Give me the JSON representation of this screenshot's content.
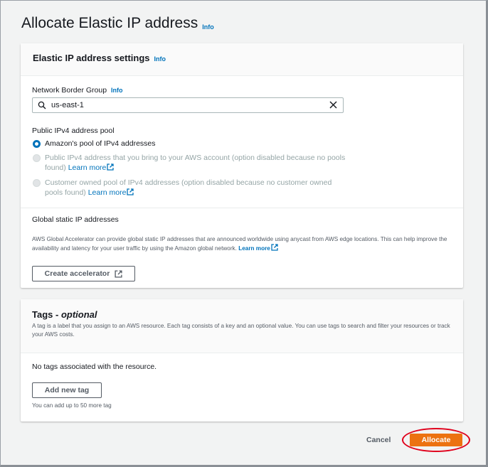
{
  "page": {
    "title": "Allocate Elastic IP address",
    "info": "Info"
  },
  "settings": {
    "header": "Elastic IP address settings",
    "info": "Info",
    "network_border_group": {
      "label": "Network Border Group",
      "info": "Info",
      "value": "us-east-1"
    },
    "pool": {
      "label": "Public IPv4 address pool",
      "options": [
        {
          "text": "Amazon's pool of IPv4 addresses",
          "selected": true,
          "disabled": false
        },
        {
          "text": "Public IPv4 address that you bring to your AWS account (option disabled because no pools found)",
          "link": "Learn more",
          "selected": false,
          "disabled": true
        },
        {
          "text": "Customer owned pool of IPv4 addresses (option disabled because no customer owned pools found)",
          "link": "Learn more",
          "selected": false,
          "disabled": true
        }
      ]
    },
    "global_static": {
      "title": "Global static IP addresses",
      "description": "AWS Global Accelerator can provide global static IP addresses that are announced worldwide using anycast from AWS edge locations. This can help improve the availability and latency for your user traffic by using the Amazon global network.",
      "link": "Learn more",
      "button": "Create accelerator"
    }
  },
  "tags": {
    "title": "Tags - ",
    "title_optional": "optional",
    "description": "A tag is a label that you assign to an AWS resource. Each tag consists of a key and an optional value. You can use tags to search and filter your resources or track your AWS costs.",
    "empty": "No tags associated with the resource.",
    "add_button": "Add new tag",
    "limit_note": "You can add up to 50 more tag"
  },
  "footer": {
    "cancel": "Cancel",
    "allocate": "Allocate"
  },
  "colors": {
    "link": "#0073bb",
    "primary_button": "#ec7211",
    "highlight_ring": "#e0001b"
  },
  "icons": [
    "search-icon",
    "clear-icon",
    "external-link-icon"
  ]
}
